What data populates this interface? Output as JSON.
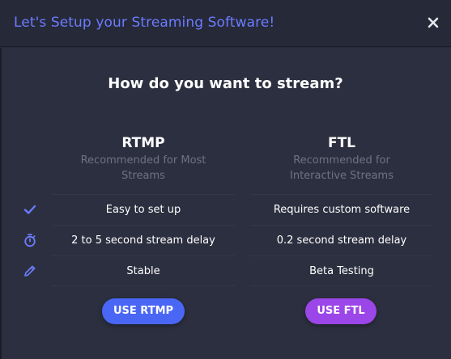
{
  "dialog": {
    "title": "Let's Setup your Streaming Software!",
    "close_icon": "close-icon",
    "accent_color": "#6b7cff"
  },
  "question": "How do you want to stream?",
  "options": [
    {
      "name": "RTMP",
      "subtitle": "Recommended for Most Streams",
      "button_label": "USE RTMP",
      "button_color": "#4a66f4"
    },
    {
      "name": "FTL",
      "subtitle": "Recommended for Interactive Streams",
      "button_label": "USE FTL",
      "button_color": "#9b46e8"
    }
  ],
  "rows": [
    {
      "icon": "checkmark-icon",
      "rtmp": "Easy to set up",
      "ftl": "Requires custom software"
    },
    {
      "icon": "stopwatch-icon",
      "rtmp": "2 to 5 second stream delay",
      "ftl": "0.2 second stream delay"
    },
    {
      "icon": "pencil-icon",
      "rtmp": "Stable",
      "ftl": "Beta Testing"
    }
  ]
}
